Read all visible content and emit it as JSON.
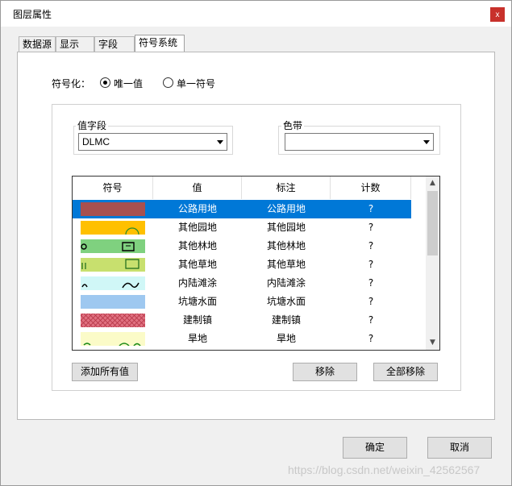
{
  "window": {
    "title": "图层属性",
    "close_label": "x"
  },
  "tabs": [
    {
      "label": "数据源"
    },
    {
      "label": "显示"
    },
    {
      "label": "字段"
    },
    {
      "label": "符号系统"
    }
  ],
  "symbolize": {
    "label": "符号化：",
    "options": [
      {
        "label": "唯一值",
        "checked": true
      },
      {
        "label": "单一符号",
        "checked": false
      }
    ]
  },
  "value_field": {
    "group_label": "值字段",
    "selected": "DLMC"
  },
  "color_ramp": {
    "group_label": "色带",
    "selected": ""
  },
  "table": {
    "columns": [
      "符号",
      "值",
      "标注",
      "计数"
    ],
    "rows": [
      {
        "value": "公路用地",
        "label": "公路用地",
        "count": "?",
        "color": "#a85050",
        "pattern": "solid",
        "selected": true
      },
      {
        "value": "其他园地",
        "label": "其他园地",
        "count": "?",
        "color": "#ffc000",
        "pattern": "arc",
        "selected": false
      },
      {
        "value": "其他林地",
        "label": "其他林地",
        "count": "?",
        "color": "#7fd17f",
        "pattern": "tree",
        "selected": false
      },
      {
        "value": "其他草地",
        "label": "其他草地",
        "count": "?",
        "color": "#c8e06e",
        "pattern": "grass",
        "selected": false
      },
      {
        "value": "内陆滩涂",
        "label": "内陆滩涂",
        "count": "?",
        "color": "#d0f7f7",
        "pattern": "wave",
        "selected": false
      },
      {
        "value": "坑塘水面",
        "label": "坑塘水面",
        "count": "?",
        "color": "#9ec8f0",
        "pattern": "solid",
        "selected": false
      },
      {
        "value": "建制镇",
        "label": "建制镇",
        "count": "?",
        "color": "#e07080",
        "pattern": "cross",
        "selected": false
      },
      {
        "value": "旱地",
        "label": "旱地",
        "count": "?",
        "color": "#fbfbc8",
        "pattern": "dry",
        "selected": false
      }
    ]
  },
  "buttons": {
    "add_all": "添加所有值",
    "remove": "移除",
    "remove_all": "全部移除",
    "ok": "确定",
    "cancel": "取消"
  },
  "watermark": "https://blog.csdn.net/weixin_42562567"
}
